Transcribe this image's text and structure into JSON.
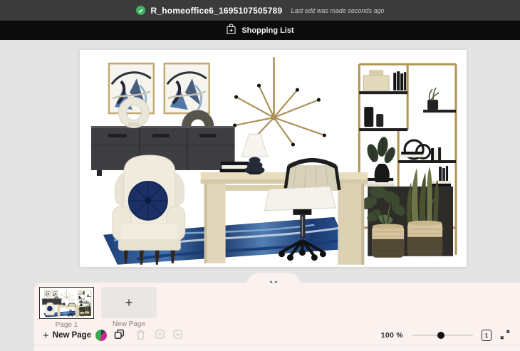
{
  "header": {
    "filename": "R_homeoffice6_1695107505789",
    "last_edit_note": "Last edit was made seconds ago",
    "saved_indicator_color": "#3bb564",
    "bar_color": "#3b3b3b"
  },
  "action_bar": {
    "bg_color": "#0b0b0b",
    "shopping_list_label": "Shopping List"
  },
  "canvas": {
    "bg_color": "#e4e4e4",
    "page_bg_color": "#ffffff",
    "moodboard_items": [
      "pair of abstract wall art in gold frames",
      "gold sputnik chandelier",
      "black credenza sideboard",
      "white ring vase",
      "charcoal arch vase",
      "gold etagere bookshelf with books and decor",
      "black accent cabinet with gold leaf print",
      "monstera and snake plants in two-tone woven baskets",
      "blue abstract area rug",
      "light wood writing desk",
      "navy gourd table lamp with white shade",
      "stack of books",
      "black cane-back office chair with white cushion",
      "cream wingback armchair with round navy pillow"
    ]
  },
  "pages_panel": {
    "bg_color": "#fbf1ee",
    "pages": [
      {
        "label": "Page 1",
        "selected": true
      }
    ],
    "new_page_tile": {
      "label": "New Page",
      "plus_glyph": "+"
    },
    "toolbar": {
      "new_page_button": {
        "label": "New Page",
        "plus_glyph": "+"
      },
      "zoom_label": "100 %",
      "zoom_percent": 100,
      "page_indicator": "1"
    }
  }
}
